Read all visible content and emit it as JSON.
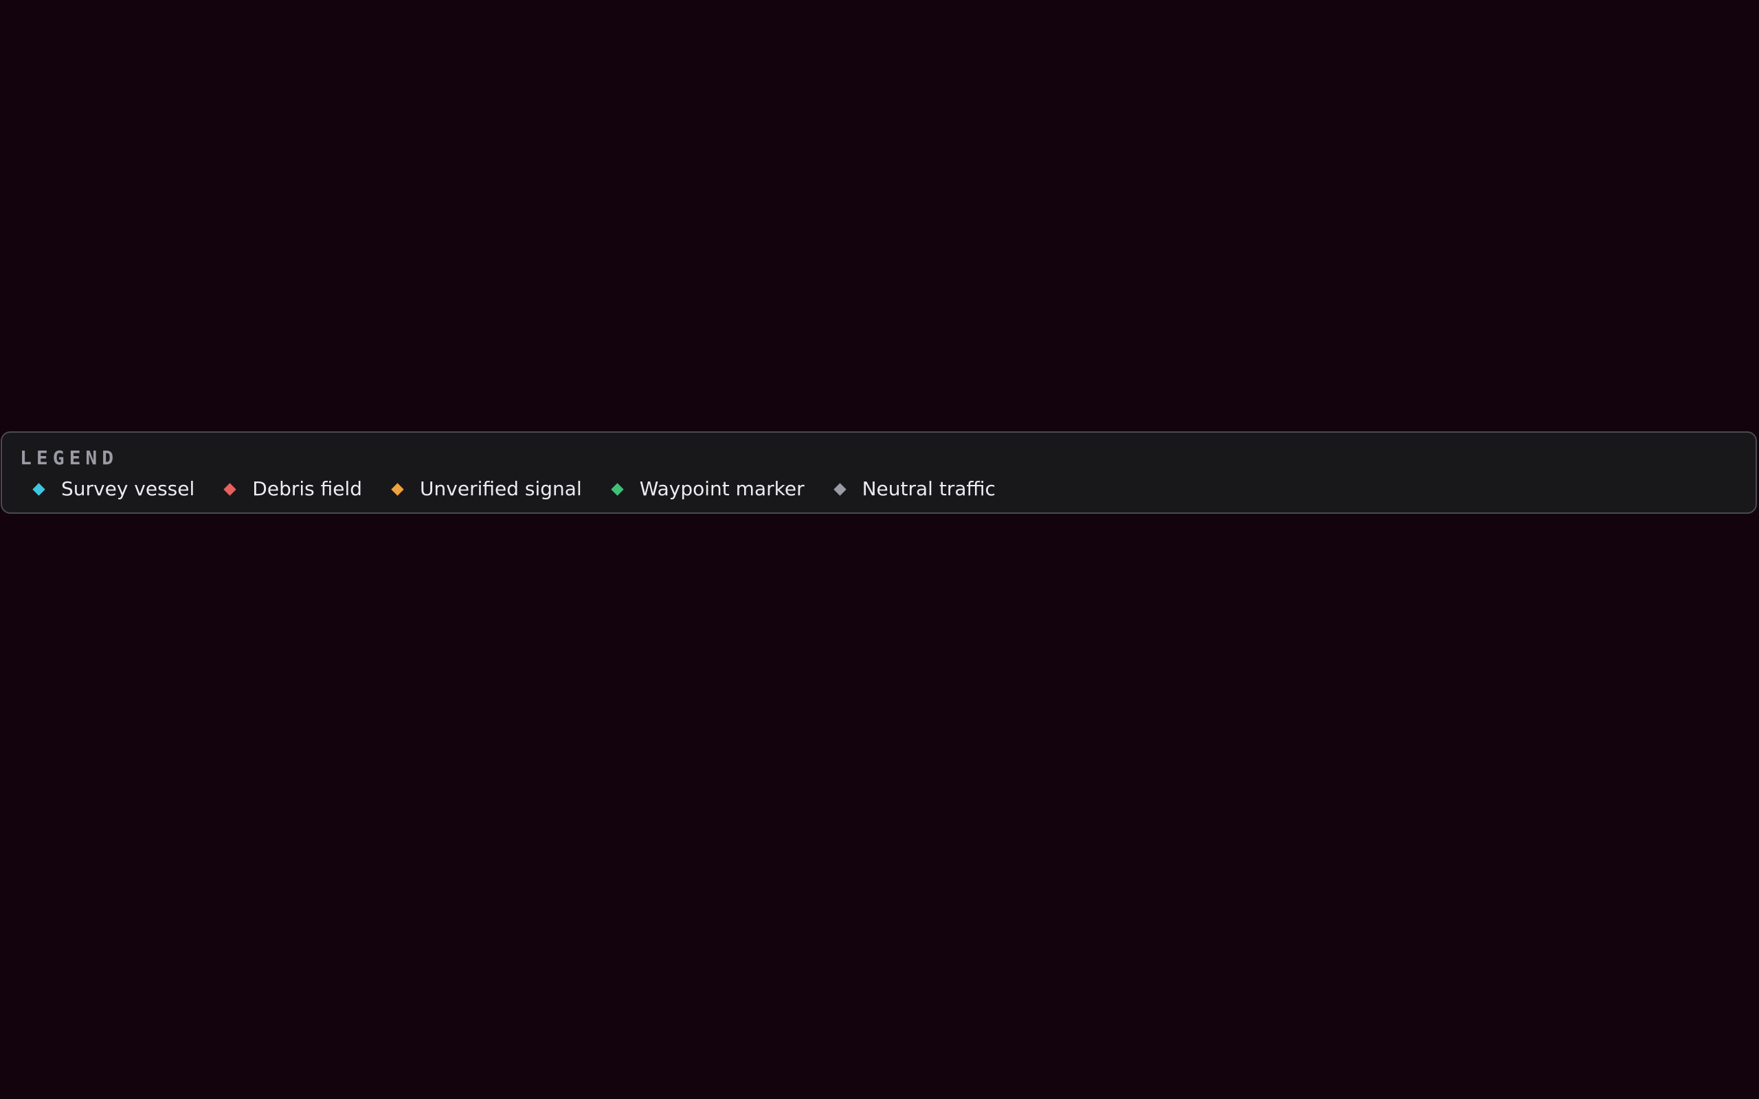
{
  "legend": {
    "title": "LEGEND",
    "items": [
      {
        "label": "Survey vessel",
        "icon": "diamond-icon",
        "color": "#3ec6e0"
      },
      {
        "label": "Debris field",
        "icon": "diamond-icon",
        "color": "#e8605e"
      },
      {
        "label": "Unverified signal",
        "icon": "diamond-icon",
        "color": "#f0a23c"
      },
      {
        "label": "Waypoint marker",
        "icon": "diamond-icon",
        "color": "#3fbf78"
      },
      {
        "label": "Neutral traffic",
        "icon": "diamond-icon",
        "color": "#9a9ba3"
      }
    ]
  },
  "colors": {
    "background": "#12030c",
    "panel": "#18181b",
    "panel_border": "#4a4a50",
    "title_text": "#9a9ba3",
    "item_text": "#ecebef"
  }
}
